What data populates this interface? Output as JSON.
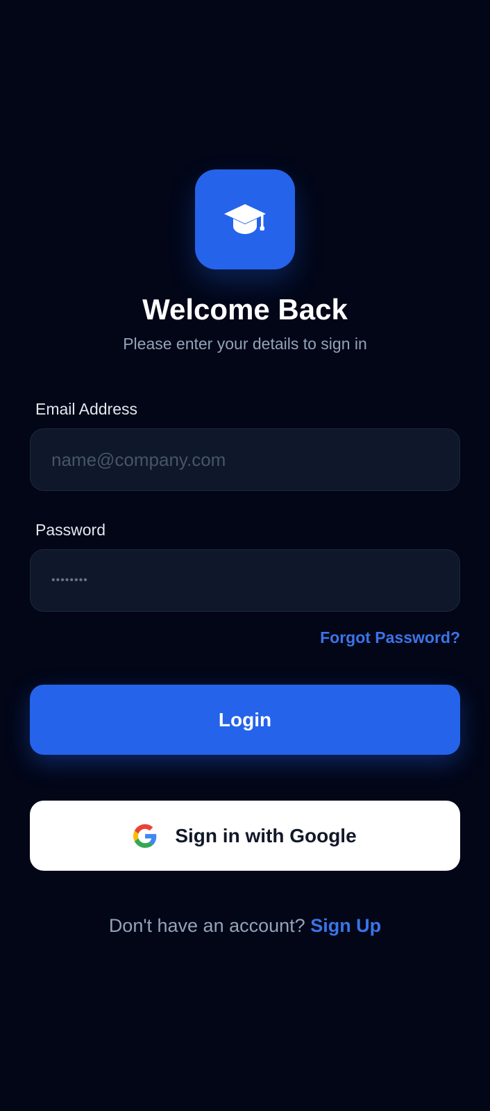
{
  "header": {
    "logo_icon": "graduation-cap-icon",
    "title": "Welcome Back",
    "subtitle": "Please enter your details to sign in"
  },
  "form": {
    "email": {
      "label": "Email Address",
      "placeholder": "name@company.com",
      "value": ""
    },
    "password": {
      "label": "Password",
      "masked_value": "••••••••"
    },
    "forgot_label": "Forgot Password?",
    "login_label": "Login",
    "google_label": "Sign in with Google",
    "google_icon": "google-icon"
  },
  "footer": {
    "prompt": "Don't have an account?",
    "signup_label": "Sign Up"
  },
  "colors": {
    "background": "#020617",
    "accent": "#2563eb",
    "link": "#3b74e8",
    "input_background": "#0f172a",
    "muted_text": "#94a3b8"
  }
}
